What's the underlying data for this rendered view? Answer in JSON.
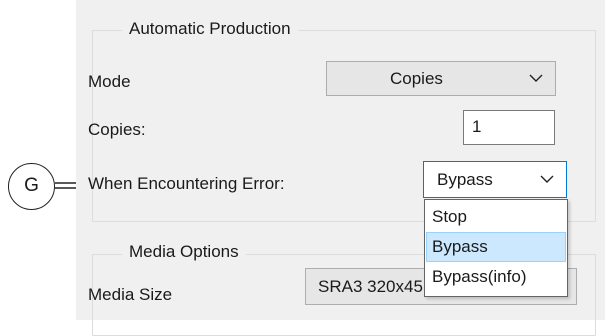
{
  "callout": {
    "letter": "G"
  },
  "automatic_production": {
    "title": "Automatic Production",
    "mode_label": "Mode",
    "mode_value": "Copies",
    "copies_label": "Copies:",
    "copies_value": "1",
    "error_label": "When Encountering Error:",
    "error_value": "Bypass",
    "error_options": [
      "Stop",
      "Bypass",
      "Bypass(info)"
    ],
    "error_selected_option": "Bypass"
  },
  "media_options": {
    "title": "Media Options",
    "size_label": "Media Size",
    "size_value": "SRA3 320x45"
  },
  "icons": {
    "dropdown": "chevron-down-icon"
  },
  "colors": {
    "panel_bg": "#f0f0f0",
    "focus_border": "#0078d7",
    "selected_item_bg": "#cce8ff",
    "selected_item_border": "#99d1ff"
  }
}
